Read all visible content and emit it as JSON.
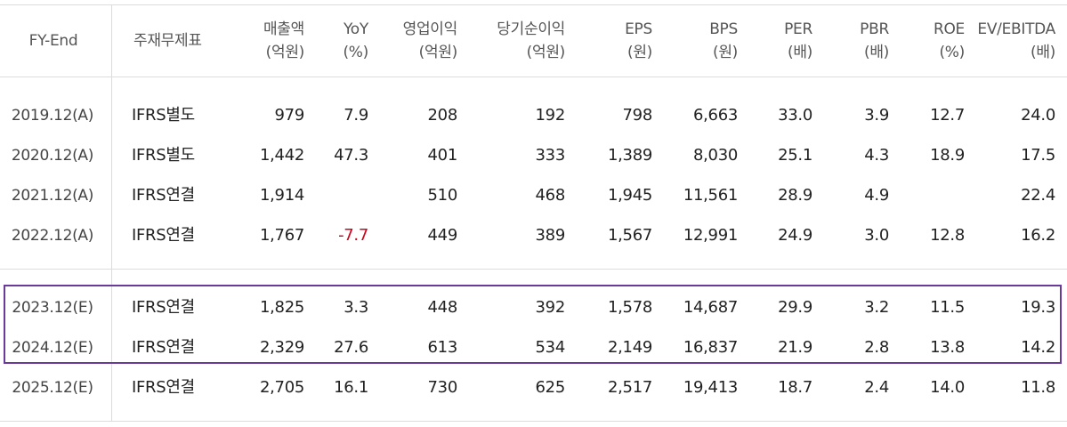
{
  "table": {
    "headers": [
      {
        "main": "FY-End",
        "sub": ""
      },
      {
        "main": "주재무제표",
        "sub": ""
      },
      {
        "main": "매출액",
        "sub": "(억원)"
      },
      {
        "main": "YoY",
        "sub": "(%)"
      },
      {
        "main": "영업이익",
        "sub": "(억원)"
      },
      {
        "main": "당기순이익",
        "sub": "(억원)"
      },
      {
        "main": "EPS",
        "sub": "(원)"
      },
      {
        "main": "BPS",
        "sub": "(원)"
      },
      {
        "main": "PER",
        "sub": "(배)"
      },
      {
        "main": "PBR",
        "sub": "(배)"
      },
      {
        "main": "ROE",
        "sub": "(%)"
      },
      {
        "main": "EV/EBITDA",
        "sub": "(배)"
      }
    ],
    "rows": [
      [
        "2019.12(A)",
        "IFRS별도",
        "979",
        "7.9",
        "208",
        "192",
        "798",
        "6,663",
        "33.0",
        "3.9",
        "12.7",
        "24.0"
      ],
      [
        "2020.12(A)",
        "IFRS별도",
        "1,442",
        "47.3",
        "401",
        "333",
        "1,389",
        "8,030",
        "25.1",
        "4.3",
        "18.9",
        "17.5"
      ],
      [
        "2021.12(A)",
        "IFRS연결",
        "1,914",
        "",
        "510",
        "468",
        "1,945",
        "11,561",
        "28.9",
        "4.9",
        "",
        "22.4"
      ],
      [
        "2022.12(A)",
        "IFRS연결",
        "1,767",
        "-7.7",
        "449",
        "389",
        "1,567",
        "12,991",
        "24.9",
        "3.0",
        "12.8",
        "16.2"
      ],
      [
        "2023.12(E)",
        "IFRS연결",
        "1,825",
        "3.3",
        "448",
        "392",
        "1,578",
        "14,687",
        "29.9",
        "3.2",
        "11.5",
        "19.3"
      ],
      [
        "2024.12(E)",
        "IFRS연결",
        "2,329",
        "27.6",
        "613",
        "534",
        "2,149",
        "16,837",
        "21.9",
        "2.8",
        "13.8",
        "14.2"
      ],
      [
        "2025.12(E)",
        "IFRS연결",
        "2,705",
        "16.1",
        "730",
        "625",
        "2,517",
        "19,413",
        "18.7",
        "2.4",
        "14.0",
        "11.8"
      ]
    ]
  },
  "colors": {
    "negative": "#d0021b",
    "highlight_border": "#6a3a9a",
    "grid": "#dcdcdc"
  }
}
